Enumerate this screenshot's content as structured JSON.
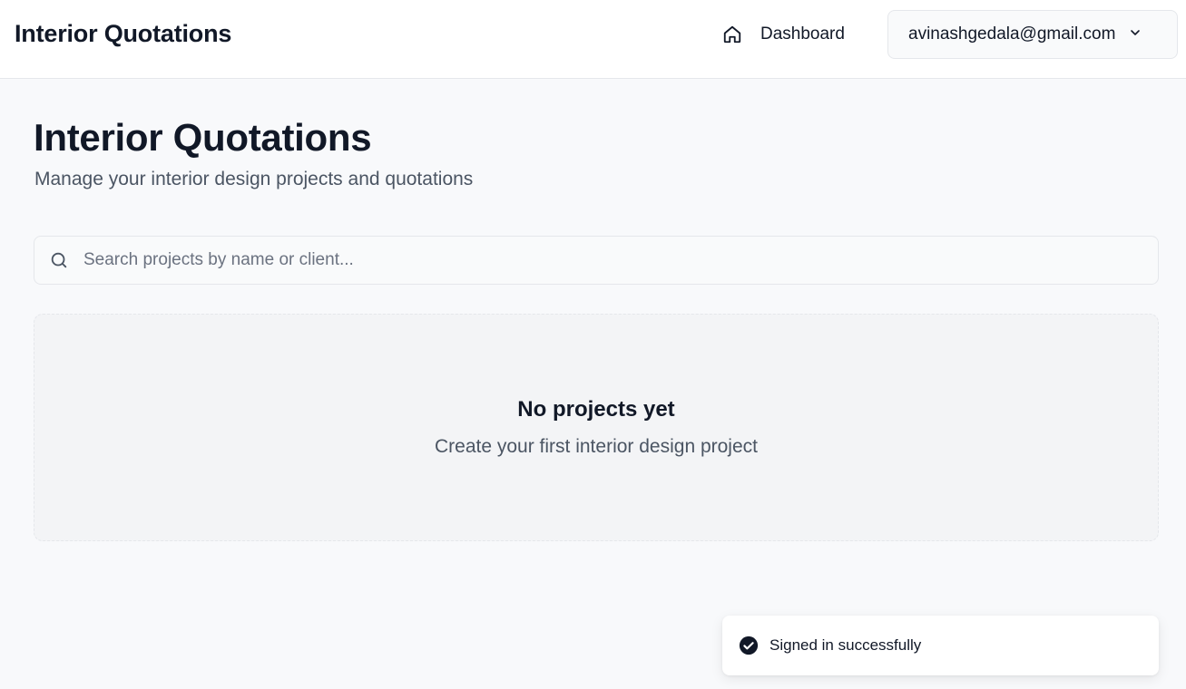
{
  "header": {
    "brand": "Interior Quotations",
    "nav": {
      "dashboard_label": "Dashboard",
      "dashboard_icon": "home-icon"
    },
    "user_menu": {
      "email": "avinashgedala@gmail.com",
      "icon": "chevron-down-icon"
    }
  },
  "main": {
    "title": "Interior Quotations",
    "subtitle": "Manage your interior design projects and quotations",
    "search": {
      "placeholder": "Search projects by name or client...",
      "value": "",
      "icon": "search-icon"
    },
    "empty_state": {
      "title": "No projects yet",
      "subtitle": "Create your first interior design project"
    }
  },
  "toast": {
    "message": "Signed in successfully",
    "icon": "check-circle-icon"
  },
  "colors": {
    "background": "#f8f9fb",
    "header_background": "#ffffff",
    "text_primary": "#111827",
    "text_secondary": "#4b5563",
    "border": "#e5e7eb",
    "empty_state_background": "#f3f4f6"
  }
}
